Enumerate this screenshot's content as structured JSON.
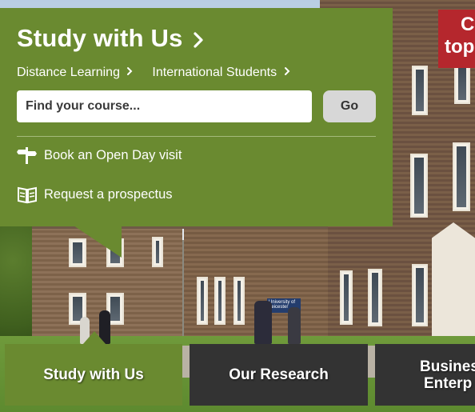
{
  "panel": {
    "title": "Study with Us",
    "links": [
      {
        "label": "Distance Learning"
      },
      {
        "label": "International Students"
      }
    ],
    "search": {
      "placeholder": "Find your course...",
      "value": "",
      "button_label": "Go"
    },
    "actions": {
      "open_day": "Book an Open Day visit",
      "prospectus": "Request a prospectus"
    }
  },
  "badge": {
    "line1": "C",
    "line2": "top"
  },
  "photo": {
    "sign_text": "University of Leicester"
  },
  "tabs": {
    "study": "Study with Us",
    "research": "Our Research",
    "business_line1": "Busines",
    "business_line2": "Enterp"
  },
  "colors": {
    "panel_green": "#6a8a30",
    "tab_dark": "#333333",
    "badge_red": "#b5272d",
    "go_button": "#d7d7d7"
  },
  "icons": [
    "chevron-right-icon",
    "signpost-icon",
    "book-icon"
  ]
}
